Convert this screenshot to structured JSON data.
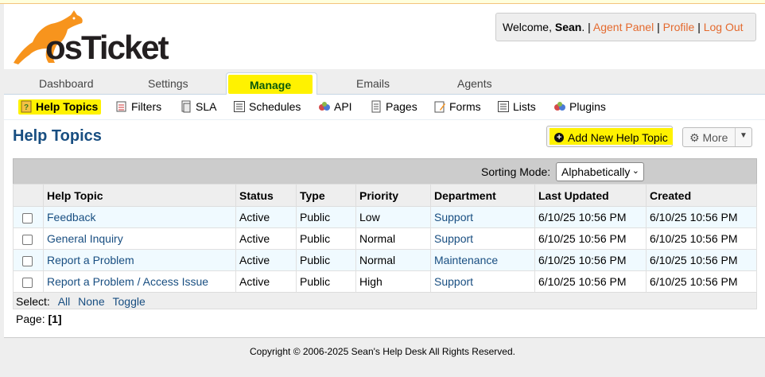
{
  "header": {
    "logo_text": "osTicket",
    "welcome_prefix": "Welcome,",
    "user_name": "Sean",
    "links": [
      "Agent Panel",
      "Profile",
      "Log Out"
    ],
    "separator": "|"
  },
  "nav": {
    "tabs": [
      "Dashboard",
      "Settings",
      "Manage",
      "Emails",
      "Agents"
    ],
    "active_tab": "Manage"
  },
  "subnav": {
    "items": [
      "Help Topics",
      "Filters",
      "SLA",
      "Schedules",
      "API",
      "Pages",
      "Forms",
      "Lists",
      "Plugins"
    ],
    "active_item": "Help Topics"
  },
  "page": {
    "title": "Help Topics",
    "add_button": "Add New Help Topic",
    "more_button": "More"
  },
  "sorting": {
    "label": "Sorting Mode:",
    "selected": "Alphabetically"
  },
  "table": {
    "columns": [
      "Help Topic",
      "Status",
      "Type",
      "Priority",
      "Department",
      "Last Updated",
      "Created"
    ],
    "rows": [
      {
        "topic": "Feedback",
        "status": "Active",
        "type": "Public",
        "priority": "Low",
        "department": "Support",
        "updated": "6/10/25 10:56 PM",
        "created": "6/10/25 10:56 PM"
      },
      {
        "topic": "General Inquiry",
        "status": "Active",
        "type": "Public",
        "priority": "Normal",
        "department": "Support",
        "updated": "6/10/25 10:56 PM",
        "created": "6/10/25 10:56 PM"
      },
      {
        "topic": "Report a Problem",
        "status": "Active",
        "type": "Public",
        "priority": "Normal",
        "department": "Maintenance",
        "updated": "6/10/25 10:56 PM",
        "created": "6/10/25 10:56 PM"
      },
      {
        "topic": "Report a Problem / Access Issue",
        "status": "Active",
        "type": "Public",
        "priority": "High",
        "department": "Support",
        "updated": "6/10/25 10:56 PM",
        "created": "6/10/25 10:56 PM"
      }
    ]
  },
  "select": {
    "label": "Select:",
    "options": [
      "All",
      "None",
      "Toggle"
    ]
  },
  "pager": {
    "label": "Page:",
    "current": "[1]"
  },
  "footer": {
    "text": "Copyright © 2006-2025 Sean's Help Desk All Rights Reserved."
  },
  "colors": {
    "accent": "#184e81",
    "link_orange": "#e46a2e",
    "highlight": "#fff200"
  }
}
